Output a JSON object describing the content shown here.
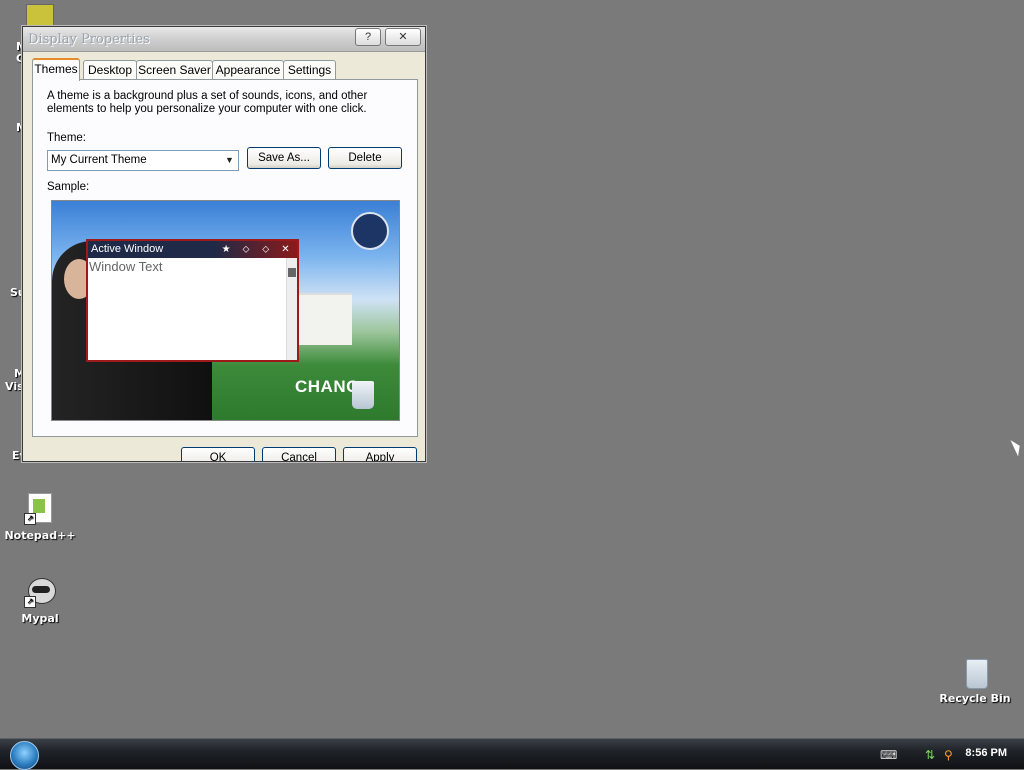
{
  "window": {
    "title": "Display Properties",
    "help_label": "?",
    "close_label": "✕"
  },
  "tabs": [
    "Themes",
    "Desktop",
    "Screen Saver",
    "Appearance",
    "Settings"
  ],
  "themes": {
    "description": "A theme is a background plus a set of sounds, icons, and other elements to help you personalize your computer with one click.",
    "theme_label": "Theme:",
    "theme_value": "My Current Theme",
    "save_as_label": "Save As...",
    "delete_label": "Delete",
    "sample_label": "Sample:",
    "sample": {
      "active_window_title": "Active Window",
      "window_text": "Window Text",
      "background_text": "CHANG"
    }
  },
  "footer": {
    "ok": "OK",
    "cancel": "Cancel",
    "apply": "Apply"
  },
  "desktop_icons": [
    {
      "label": "Notepad++",
      "icon": "notepad-plus-plus-icon"
    },
    {
      "label": "Mypal",
      "icon": "mypal-icon"
    },
    {
      "label": "Recycle Bin",
      "icon": "recycle-bin-icon"
    }
  ],
  "partial_labels": [
    "M",
    "C",
    "M",
    "Su",
    "M",
    "Visi",
    "Ev"
  ],
  "taskbar": {
    "clock": "8:56 PM"
  }
}
